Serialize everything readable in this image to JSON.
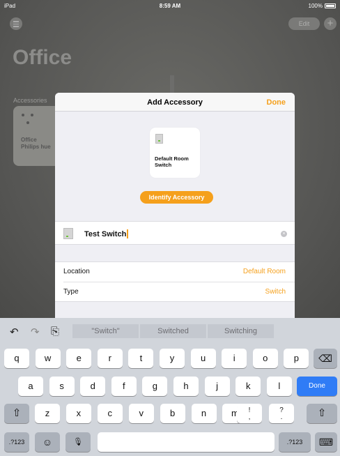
{
  "status_bar": {
    "carrier": "iPad",
    "time": "8:59 AM",
    "battery": "100%"
  },
  "background": {
    "edit_label": "Edit",
    "plus_label": "+",
    "room_title": "Office",
    "accessories_label": "Accessories",
    "tile": {
      "line1": "Office",
      "line2": "Philips hue"
    }
  },
  "sheet": {
    "title": "Add Accessory",
    "done_label": "Done",
    "card_name": "Default Room Switch",
    "identify_label": "Identify Accessory",
    "name_value": "Test Switch",
    "rows": [
      {
        "key": "Location",
        "value": "Default Room"
      },
      {
        "key": "Type",
        "value": "Switch"
      }
    ]
  },
  "keyboard": {
    "shortcuts": {
      "undo": "↶",
      "redo": "↷",
      "paste": "⎘"
    },
    "suggestions": [
      "\"Switch\"",
      "Switched",
      "Switching"
    ],
    "row1": [
      "q",
      "w",
      "e",
      "r",
      "t",
      "y",
      "u",
      "i",
      "o",
      "p"
    ],
    "row2": [
      "a",
      "s",
      "d",
      "f",
      "g",
      "h",
      "j",
      "k",
      "l"
    ],
    "row3": [
      "z",
      "x",
      "c",
      "v",
      "b",
      "n",
      "m"
    ],
    "punct1": {
      "top": "!",
      "bottom": ","
    },
    "punct2": {
      "top": "?",
      "bottom": "."
    },
    "done_label": "Done",
    "backspace_label": "⌫",
    "shift_label": "⇧",
    "numbers_label": ".?123",
    "emoji_label": "☺",
    "mic_label": "🎙",
    "hide_label": "⌨"
  }
}
